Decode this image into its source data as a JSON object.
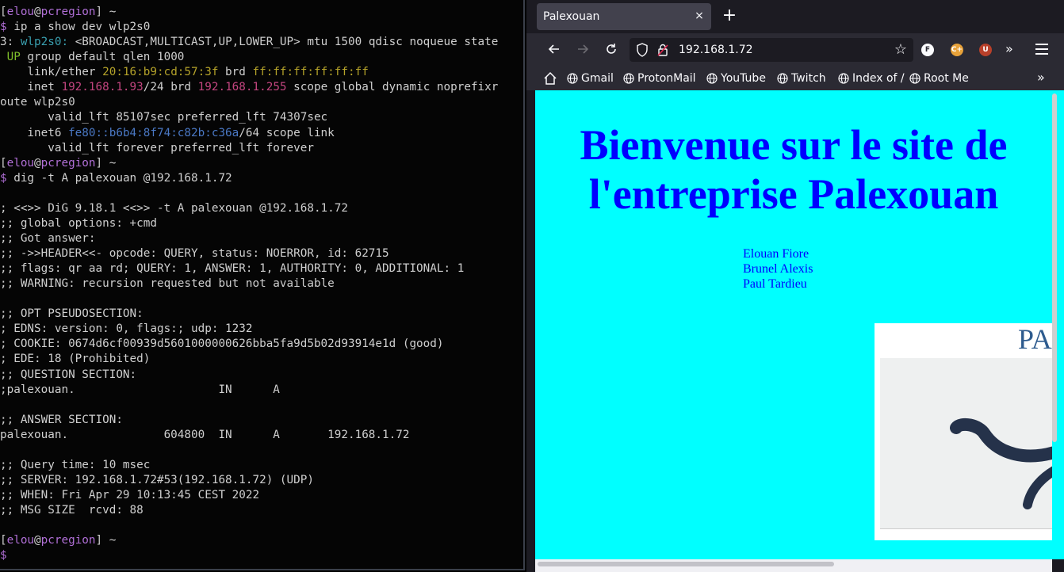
{
  "terminal": {
    "lines": [
      [
        {
          "t": "[",
          "c": "gray"
        },
        {
          "t": "elou",
          "c": "purple"
        },
        {
          "t": "@",
          "c": "gray"
        },
        {
          "t": "pcregion",
          "c": "purple"
        },
        {
          "t": "] ~",
          "c": "gray"
        }
      ],
      [
        {
          "t": "$ ",
          "c": "purple"
        },
        {
          "t": "ip a show dev wlp2s0",
          "c": "gray"
        }
      ],
      [
        {
          "t": "3: ",
          "c": "gray"
        },
        {
          "t": "wlp2s0:",
          "c": "teal"
        },
        {
          "t": " <BROADCAST,MULTICAST,UP,LOWER_UP> mtu 1500 qdisc noqueue state",
          "c": "gray"
        }
      ],
      [
        {
          "t": " UP",
          "c": "green"
        },
        {
          "t": " group default qlen 1000",
          "c": "gray"
        }
      ],
      [
        {
          "t": "    link/ether ",
          "c": "gray"
        },
        {
          "t": "20:16:b9:cd:57:3f",
          "c": "yellow"
        },
        {
          "t": " brd ",
          "c": "gray"
        },
        {
          "t": "ff:ff:ff:ff:ff:ff",
          "c": "yellow"
        }
      ],
      [
        {
          "t": "    inet ",
          "c": "gray"
        },
        {
          "t": "192.168.1.93",
          "c": "magenta"
        },
        {
          "t": "/24 brd ",
          "c": "gray"
        },
        {
          "t": "192.168.1.255",
          "c": "magenta"
        },
        {
          "t": " scope global dynamic noprefixr",
          "c": "gray"
        }
      ],
      [
        {
          "t": "oute wlp2s0",
          "c": "gray"
        }
      ],
      [
        {
          "t": "       valid_lft 85107sec preferred_lft 74307sec",
          "c": "gray"
        }
      ],
      [
        {
          "t": "    inet6 ",
          "c": "gray"
        },
        {
          "t": "fe80::b6b4:8f74:c82b:c36a",
          "c": "blue"
        },
        {
          "t": "/64 scope link",
          "c": "gray"
        }
      ],
      [
        {
          "t": "       valid_lft forever preferred_lft forever",
          "c": "gray"
        }
      ],
      [
        {
          "t": "[",
          "c": "gray"
        },
        {
          "t": "elou",
          "c": "purple"
        },
        {
          "t": "@",
          "c": "gray"
        },
        {
          "t": "pcregion",
          "c": "purple"
        },
        {
          "t": "] ~",
          "c": "gray"
        }
      ],
      [
        {
          "t": "$ ",
          "c": "purple"
        },
        {
          "t": "dig -t A palexouan @192.168.1.72",
          "c": "gray"
        }
      ],
      [
        {
          "t": "",
          "c": "gray"
        }
      ],
      [
        {
          "t": "; <<>> DiG 9.18.1 <<>> -t A palexouan @192.168.1.72",
          "c": "gray"
        }
      ],
      [
        {
          "t": ";; global options: +cmd",
          "c": "gray"
        }
      ],
      [
        {
          "t": ";; Got answer:",
          "c": "gray"
        }
      ],
      [
        {
          "t": ";; ->>HEADER<<- opcode: QUERY, status: NOERROR, id: 62715",
          "c": "gray"
        }
      ],
      [
        {
          "t": ";; flags: qr aa rd; QUERY: 1, ANSWER: 1, AUTHORITY: 0, ADDITIONAL: 1",
          "c": "gray"
        }
      ],
      [
        {
          "t": ";; WARNING: recursion requested but not available",
          "c": "gray"
        }
      ],
      [
        {
          "t": "",
          "c": "gray"
        }
      ],
      [
        {
          "t": ";; OPT PSEUDOSECTION:",
          "c": "gray"
        }
      ],
      [
        {
          "t": "; EDNS: version: 0, flags:; udp: 1232",
          "c": "gray"
        }
      ],
      [
        {
          "t": "; COOKIE: 0674d6cf00939d5601000000626bba5fa9d5b02d93914e1d (good)",
          "c": "gray"
        }
      ],
      [
        {
          "t": "; EDE: 18 (Prohibited)",
          "c": "gray"
        }
      ],
      [
        {
          "t": ";; QUESTION SECTION:",
          "c": "gray"
        }
      ],
      [
        {
          "t": ";palexouan.                     IN      A",
          "c": "gray"
        }
      ],
      [
        {
          "t": "",
          "c": "gray"
        }
      ],
      [
        {
          "t": ";; ANSWER SECTION:",
          "c": "gray"
        }
      ],
      [
        {
          "t": "palexouan.              604800  IN      A       192.168.1.72",
          "c": "gray"
        }
      ],
      [
        {
          "t": "",
          "c": "gray"
        }
      ],
      [
        {
          "t": ";; Query time: 10 msec",
          "c": "gray"
        }
      ],
      [
        {
          "t": ";; SERVER: 192.168.1.72#53(192.168.1.72) (UDP)",
          "c": "gray"
        }
      ],
      [
        {
          "t": ";; WHEN: Fri Apr 29 10:13:45 CEST 2022",
          "c": "gray"
        }
      ],
      [
        {
          "t": ";; MSG SIZE  rcvd: 88",
          "c": "gray"
        }
      ],
      [
        {
          "t": "",
          "c": "gray"
        }
      ],
      [
        {
          "t": "[",
          "c": "gray"
        },
        {
          "t": "elou",
          "c": "purple"
        },
        {
          "t": "@",
          "c": "gray"
        },
        {
          "t": "pcregion",
          "c": "purple"
        },
        {
          "t": "] ~",
          "c": "gray"
        }
      ],
      [
        {
          "t": "$",
          "c": "purple"
        }
      ]
    ]
  },
  "browser": {
    "tab": {
      "title": "Palexouan",
      "close": "×"
    },
    "new_tab": "+",
    "url": "192.168.1.72",
    "extensions": {
      "f": "F",
      "c": "C+",
      "u": "U"
    },
    "bookmarks": [
      "Gmail",
      "ProtonMail",
      "YouTube",
      "Twitch",
      "Index of /",
      "Root Me"
    ],
    "page": {
      "title": "Bienvenue sur le site de l'entreprise Palexouan",
      "names": [
        "Elouan Fiore",
        "Brunel Alexis",
        "Paul Tardieu"
      ],
      "logo_text": "PA"
    },
    "colors": {
      "page_bg": "#00ffff",
      "heading": "#0000ff",
      "logo_text": "#2e5b8e"
    }
  }
}
